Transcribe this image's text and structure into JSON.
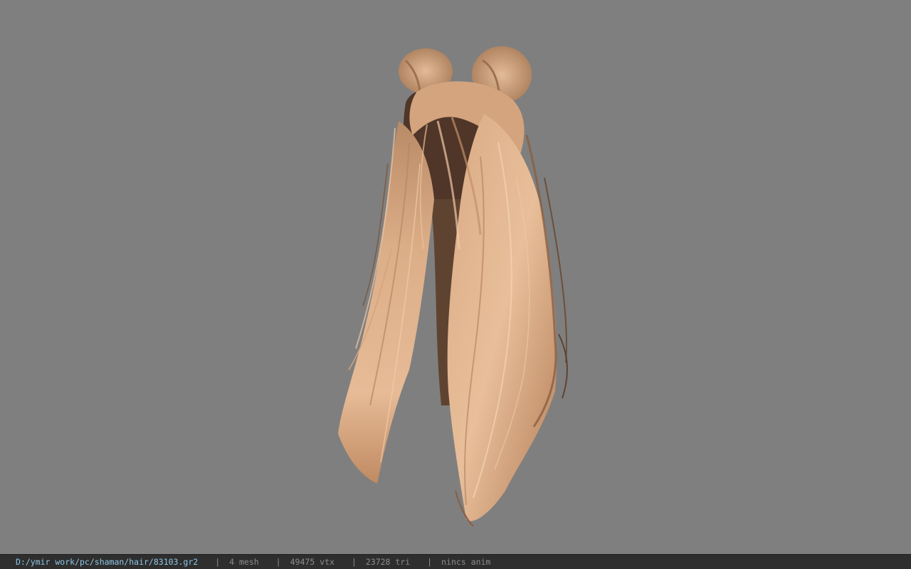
{
  "viewport": {
    "model_icon": "long-hair-twin-buns-model",
    "background_color": "#7f7f7f",
    "hair_light_color": "#e2b48e",
    "hair_mid_color": "#c9966d",
    "hair_dark_color": "#6a4a35"
  },
  "statusbar": {
    "file_path": "D:/ymir work/pc/shaman/hair/83103.gr2",
    "separator": "|",
    "mesh_count": "4 mesh",
    "vertex_count": "49475 vtx",
    "triangle_count": "23728 tri",
    "anim_status": "nincs anim",
    "path_color": "#8ec7e6",
    "text_color": "#8d8d8d"
  }
}
